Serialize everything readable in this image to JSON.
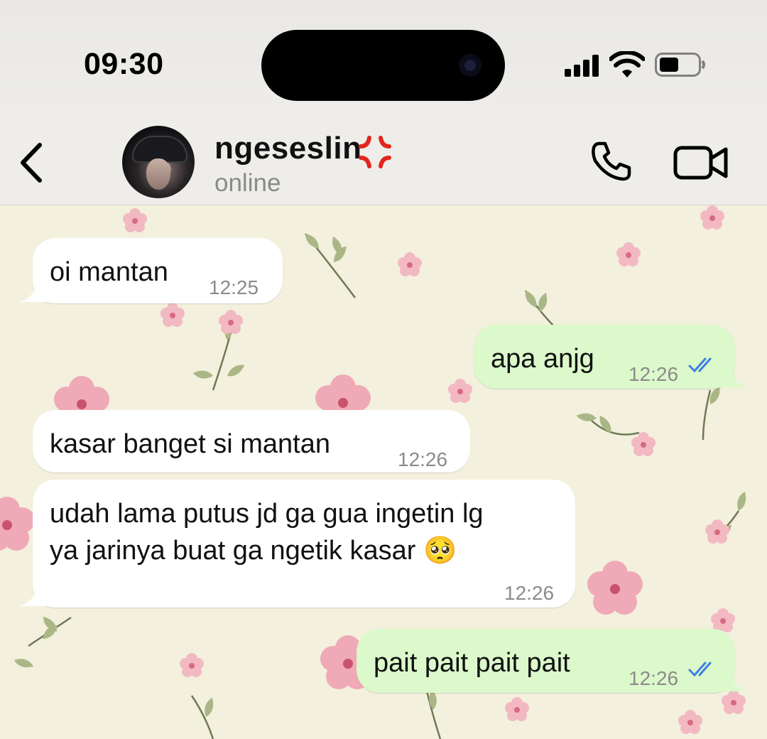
{
  "status_bar": {
    "time": "09:30"
  },
  "header": {
    "contact_name": "ngeseslin",
    "contact_status": "online",
    "icons": [
      "back-chevron-icon",
      "anger-symbol-icon",
      "phone-call-icon",
      "video-call-icon"
    ]
  },
  "messages": [
    {
      "direction": "incoming",
      "text": "oi mantan",
      "time": "12:25"
    },
    {
      "direction": "outgoing",
      "text": "apa anjg",
      "time": "12:26",
      "status": "read"
    },
    {
      "direction": "incoming",
      "text": "kasar banget si mantan",
      "time": "12:26"
    },
    {
      "direction": "incoming",
      "text": "udah lama putus jd ga gua ingetin lg\nya jarinya buat ga ngetik kasar 🥺",
      "time": "12:26"
    },
    {
      "direction": "outgoing",
      "text": "pait pait pait pait",
      "time": "12:26",
      "status": "read"
    }
  ],
  "colors": {
    "incoming_bubble": "#ffffff",
    "outgoing_bubble": "#dcf9cb",
    "read_ticks": "#3d7fe0",
    "wallpaper": "#f3f0dd"
  }
}
